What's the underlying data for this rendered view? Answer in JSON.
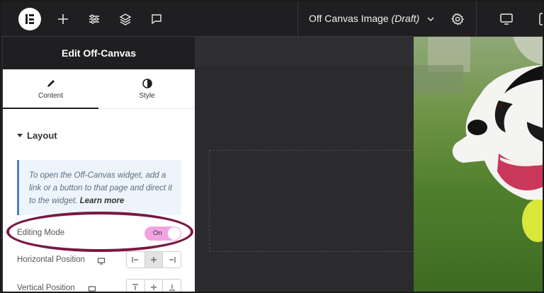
{
  "topbar": {
    "doc_title": "Off Canvas Image",
    "doc_status": "(Draft)",
    "icons": [
      "elementor-logo-icon",
      "plus-icon",
      "sliders-icon",
      "layers-icon",
      "comment-icon",
      "chevron-down-icon",
      "gear-icon",
      "desktop-icon",
      "tablet-icon"
    ]
  },
  "panel": {
    "title": "Edit Off-Canvas",
    "tabs": [
      {
        "label": "Content",
        "icon": "pencil-icon",
        "active": true
      },
      {
        "label": "Style",
        "icon": "half-circle-icon",
        "active": false
      }
    ],
    "section_title": "Layout",
    "info": {
      "text": "To open the Off-Canvas widget, add a link or a button to that page and direct it to the widget.",
      "link": "Learn more"
    },
    "editing_mode": {
      "label": "Editing Mode",
      "value": "On"
    },
    "horizontal_position": {
      "label": "Horizontal Position",
      "options": [
        "align-left-icon",
        "align-center-icon",
        "align-right-icon"
      ],
      "selected": 1
    },
    "vertical_position": {
      "label": "Vertical Position",
      "options": [
        "align-top-icon",
        "align-middle-icon",
        "align-bottom-icon"
      ]
    }
  },
  "colors": {
    "highlight": "#7a1845",
    "toggle_on": "#f3a3e4",
    "info_border": "#4a7fd0"
  }
}
